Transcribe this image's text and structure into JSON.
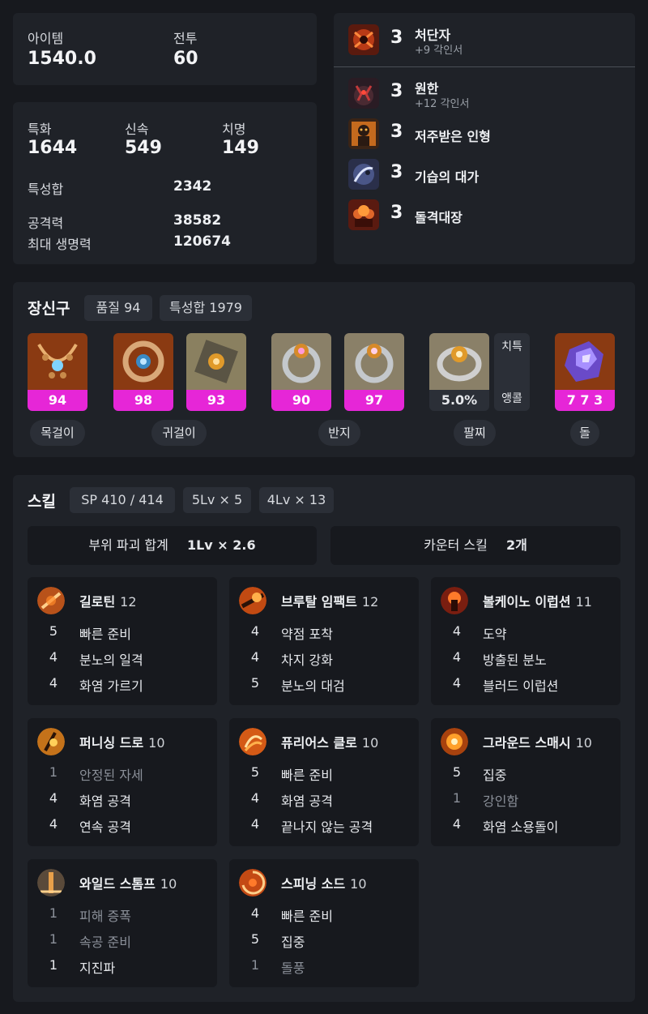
{
  "summary": {
    "item_label": "아이템",
    "item_value": "1540.0",
    "combat_label": "전투",
    "combat_value": "60"
  },
  "stats": {
    "spec_label": "특화",
    "spec_value": "1644",
    "swift_label": "신속",
    "swift_value": "549",
    "crit_label": "치명",
    "crit_value": "149",
    "total_label": "특성합",
    "total_value": "2342",
    "atk_label": "공격력",
    "atk_value": "38582",
    "hp_label": "최대 생명력",
    "hp_value": "120674"
  },
  "engravings": [
    {
      "level": "3",
      "name": "처단자",
      "sub": "+9 각인서",
      "icon": "slayer-icon"
    },
    {
      "level": "3",
      "name": "원한",
      "sub": "+12 각인서",
      "icon": "grudge-icon"
    },
    {
      "level": "3",
      "name": "저주받은 인형",
      "sub": "",
      "icon": "cursed-doll-icon"
    },
    {
      "level": "3",
      "name": "기습의 대가",
      "sub": "",
      "icon": "master-ambush-icon"
    },
    {
      "level": "3",
      "name": "돌격대장",
      "sub": "",
      "icon": "raid-captain-icon"
    }
  ],
  "accessories": {
    "title": "장신구",
    "quality_pill": "품질 94",
    "stat_pill": "특성합 1979",
    "items": [
      {
        "quality": "94",
        "icon": "necklace-icon"
      },
      {
        "quality": "98",
        "icon": "earring-icon"
      },
      {
        "quality": "93",
        "icon": "earring-icon"
      },
      {
        "quality": "90",
        "icon": "ring-icon"
      },
      {
        "quality": "97",
        "icon": "ring-icon"
      },
      {
        "quality": "5.0%",
        "icon": "bracelet-icon"
      },
      {
        "quality": "7 7 3",
        "icon": "stone-icon"
      }
    ],
    "bracelet_stats": {
      "top": "치특",
      "bottom": "앵콜"
    },
    "labels": {
      "necklace": "목걸이",
      "earring": "귀걸이",
      "ring": "반지",
      "bracelet": "팔찌",
      "stone": "돌"
    }
  },
  "skills": {
    "title": "스킬",
    "sp_pill": "SP 410 / 414",
    "lv5_pill": "5Lv × 5",
    "lv4_pill": "4Lv × 13",
    "part_break_label": "부위 파괴 합계",
    "part_break_value": "1Lv × 2.6",
    "counter_label": "카운터 스킬",
    "counter_value": "2개",
    "list": [
      {
        "name": "길로틴",
        "level": "12",
        "icon": "guillotine-icon",
        "tripods": [
          {
            "l": "5",
            "n": "빠른 준비",
            "on": true
          },
          {
            "l": "4",
            "n": "분노의 일격",
            "on": true
          },
          {
            "l": "4",
            "n": "화염 가르기",
            "on": true
          }
        ]
      },
      {
        "name": "브루탈 임팩트",
        "level": "12",
        "icon": "brutal-impact-icon",
        "tripods": [
          {
            "l": "4",
            "n": "약점 포착",
            "on": true
          },
          {
            "l": "4",
            "n": "차지 강화",
            "on": true
          },
          {
            "l": "5",
            "n": "분노의 대검",
            "on": true
          }
        ]
      },
      {
        "name": "볼케이노 이럽션",
        "level": "11",
        "icon": "volcano-eruption-icon",
        "tripods": [
          {
            "l": "4",
            "n": "도약",
            "on": true
          },
          {
            "l": "4",
            "n": "방출된 분노",
            "on": true
          },
          {
            "l": "4",
            "n": "블러드 이럽션",
            "on": true
          }
        ]
      },
      {
        "name": "퍼니싱 드로",
        "level": "10",
        "icon": "punishing-draw-icon",
        "tripods": [
          {
            "l": "1",
            "n": "안정된 자세",
            "on": false
          },
          {
            "l": "4",
            "n": "화염 공격",
            "on": true
          },
          {
            "l": "4",
            "n": "연속 공격",
            "on": true
          }
        ]
      },
      {
        "name": "퓨리어스 클로",
        "level": "10",
        "icon": "furious-claw-icon",
        "tripods": [
          {
            "l": "5",
            "n": "빠른 준비",
            "on": true
          },
          {
            "l": "4",
            "n": "화염 공격",
            "on": true
          },
          {
            "l": "4",
            "n": "끝나지 않는 공격",
            "on": true
          }
        ]
      },
      {
        "name": "그라운드 스매시",
        "level": "10",
        "icon": "ground-smash-icon",
        "tripods": [
          {
            "l": "5",
            "n": "집중",
            "on": true
          },
          {
            "l": "1",
            "n": "강인함",
            "on": false
          },
          {
            "l": "4",
            "n": "화염 소용돌이",
            "on": true
          }
        ]
      },
      {
        "name": "와일드 스톰프",
        "level": "10",
        "icon": "wild-stomp-icon",
        "tripods": [
          {
            "l": "1",
            "n": "피해 증폭",
            "on": false
          },
          {
            "l": "1",
            "n": "속공 준비",
            "on": false
          },
          {
            "l": "1",
            "n": "지진파",
            "on": true
          }
        ]
      },
      {
        "name": "스피닝 소드",
        "level": "10",
        "icon": "spinning-sword-icon",
        "tripods": [
          {
            "l": "4",
            "n": "빠른 준비",
            "on": true
          },
          {
            "l": "5",
            "n": "집중",
            "on": true
          },
          {
            "l": "1",
            "n": "돌풍",
            "on": false
          }
        ]
      }
    ]
  },
  "colors": {
    "accent": "#e626d7",
    "bg": "#17191e",
    "card": "#1f2228",
    "pill": "#2b2f37"
  }
}
